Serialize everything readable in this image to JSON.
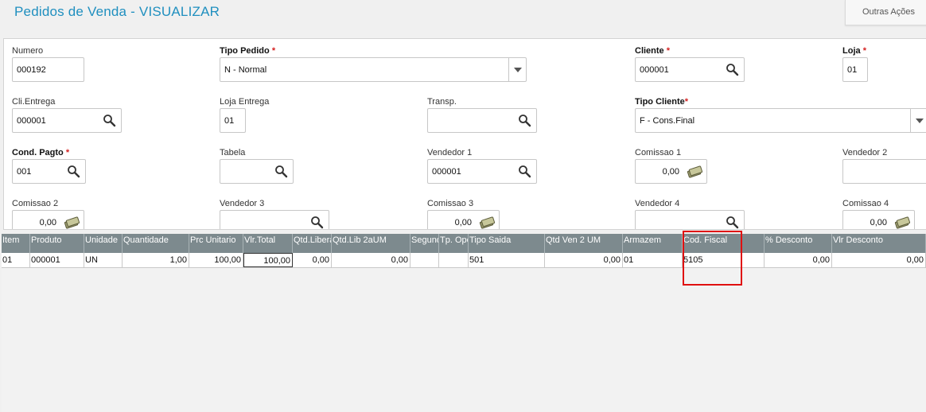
{
  "header": {
    "title": "Pedidos de Venda - VISUALIZAR",
    "actions_label": "Outras Ações"
  },
  "form": {
    "numero": {
      "label": "Numero",
      "value": "000192"
    },
    "tipo_pedido": {
      "label": "Tipo Pedido",
      "required_mark": "*",
      "value": "N - Normal"
    },
    "cliente": {
      "label": "Cliente",
      "required_mark": "*",
      "value": "000001"
    },
    "loja": {
      "label": "Loja",
      "required_mark": "*",
      "value": "01"
    },
    "cli_entrega": {
      "label": "Cli.Entrega",
      "value": "000001"
    },
    "loja_entrega": {
      "label": "Loja Entrega",
      "value": "01"
    },
    "transp": {
      "label": "Transp.",
      "value": ""
    },
    "tipo_cliente": {
      "label": "Tipo Cliente",
      "required_mark": "*",
      "value": "F - Cons.Final"
    },
    "cond_pagto": {
      "label": "Cond. Pagto",
      "required_mark": "*",
      "value": "001"
    },
    "tabela": {
      "label": "Tabela",
      "value": ""
    },
    "vendedor1": {
      "label": "Vendedor 1",
      "value": "000001"
    },
    "comissao1": {
      "label": "Comissao 1",
      "value": "0,00"
    },
    "vendedor2": {
      "label": "Vendedor 2",
      "value": ""
    },
    "comissao2": {
      "label": "Comissao 2",
      "value": "0,00"
    },
    "vendedor3": {
      "label": "Vendedor 3",
      "value": ""
    },
    "comissao3": {
      "label": "Comissao 3",
      "value": "0,00"
    },
    "vendedor4": {
      "label": "Vendedor 4",
      "value": ""
    },
    "comissao4": {
      "label": "Comissao 4",
      "value": "0,00"
    }
  },
  "grid": {
    "headers": [
      "Item",
      "Produto",
      "Unidade",
      "Quantidade",
      "Prc Unitario",
      "Vlr.Total",
      "Qtd.Liberada",
      "Qtd.Lib 2aUM",
      "Segunda",
      "Tp. Operação",
      "Tipo Saida",
      "Qtd Ven 2 UM",
      "Armazem",
      "Cod. Fiscal",
      "% Desconto",
      "Vlr Desconto"
    ],
    "rows": [
      [
        "01",
        "000001",
        "UN",
        "1,00",
        "100,00",
        "100,00",
        "0,00",
        "0,00",
        "",
        "",
        "501",
        "0,00",
        "01",
        "5105",
        "0,00",
        "0,00"
      ]
    ]
  },
  "colors": {
    "title": "#1f8fbf",
    "grid_header": "#7d8a8e",
    "required": "#d42020",
    "highlight": "#e01010"
  }
}
